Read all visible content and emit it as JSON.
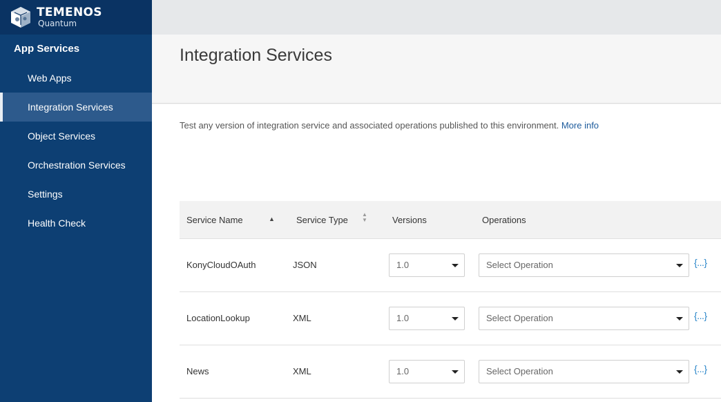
{
  "logo": {
    "main": "TEMENOS",
    "sub": "Quantum"
  },
  "sidebar": {
    "heading": "App Services",
    "items": [
      {
        "label": "Web Apps",
        "active": false
      },
      {
        "label": "Integration Services",
        "active": true
      },
      {
        "label": "Object Services",
        "active": false
      },
      {
        "label": "Orchestration Services",
        "active": false
      },
      {
        "label": "Settings",
        "active": false
      },
      {
        "label": "Health Check",
        "active": false
      }
    ]
  },
  "page": {
    "title": "Integration Services",
    "description": "Test any version of integration service and associated operations published to this environment.",
    "more_info": "More info"
  },
  "table": {
    "headers": {
      "service_name": "Service Name",
      "service_type": "Service Type",
      "versions": "Versions",
      "operations": "Operations"
    },
    "rows": [
      {
        "name": "KonyCloudOAuth",
        "type": "JSON",
        "version": "1.0",
        "operation_placeholder": "Select Operation",
        "json_icon": "{...}"
      },
      {
        "name": "LocationLookup",
        "type": "XML",
        "version": "1.0",
        "operation_placeholder": "Select Operation",
        "json_icon": "{...}"
      },
      {
        "name": "News",
        "type": "XML",
        "version": "1.0",
        "operation_placeholder": "Select Operation",
        "json_icon": "{...}"
      }
    ]
  },
  "colors": {
    "sidebar_bg": "#0d3f73",
    "sidebar_active": "#2d5a8c",
    "link": "#1d5b9c",
    "icon_accent": "#2a86c9"
  }
}
